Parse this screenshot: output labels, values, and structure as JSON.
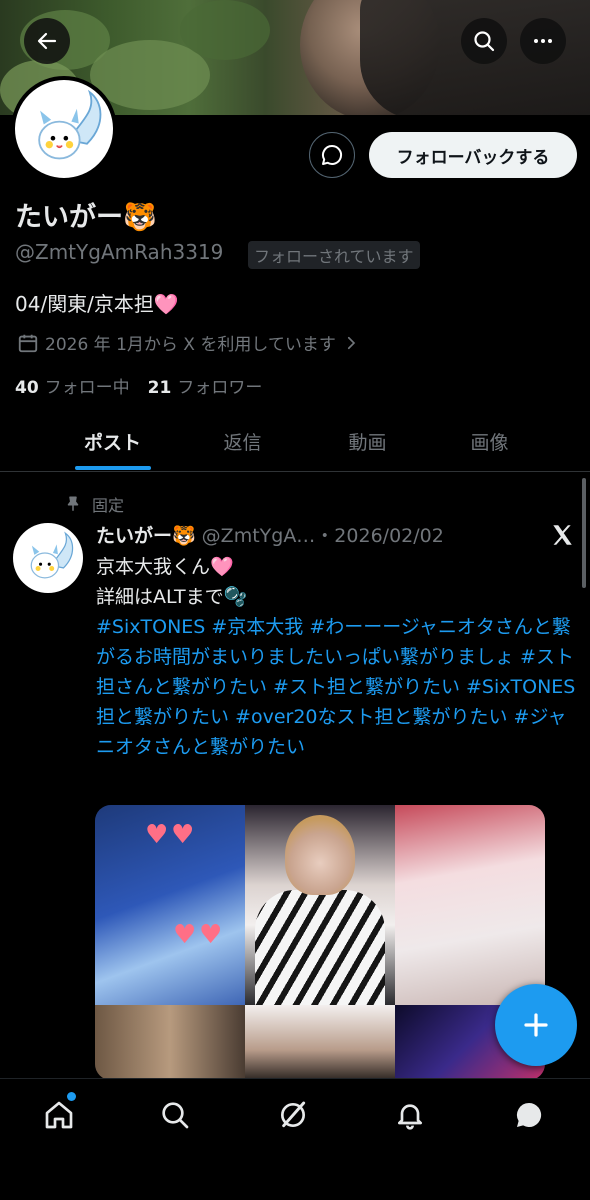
{
  "profile": {
    "display_name": "たいがー🐯",
    "handle": "@ZmtYgAmRah3319",
    "follows_you_label": "フォローされています",
    "bio": "04/関東/京本担🩷",
    "joined": "2026 年 1月から X を利用しています",
    "following_count": "40",
    "following_label": "フォロー中",
    "followers_count": "21",
    "followers_label": "フォロワー",
    "follow_back_label": "フォローバックする"
  },
  "tabs": [
    {
      "label": "ポスト",
      "active": true
    },
    {
      "label": "返信",
      "active": false
    },
    {
      "label": "動画",
      "active": false
    },
    {
      "label": "画像",
      "active": false
    }
  ],
  "post": {
    "pinned_label": "固定",
    "author_name": "たいがー🐯",
    "author_handle_time": "@ZmtYgA…・2026/02/02",
    "line1": "京本大我くん🩷",
    "line2": "詳細はALTまで🫧",
    "hashtags": "#SixTONES #京本大我 #わーーージャニオタさんと繋がるお時間がまいりましたいっぱい繋がりましょ #スト担さんと繋がりたい #スト担と繋がりたい #SixTONES担と繋がりたい #over20なスト担と繋がりたい #ジャニオタさんと繋がりたい"
  },
  "icons": {
    "back": "arrow-left-icon",
    "search": "search-icon",
    "more": "more-icon",
    "message": "message-icon",
    "calendar": "calendar-icon",
    "pin": "pin-icon",
    "x_logo": "x-logo-icon",
    "compose": "plus-icon",
    "nav": [
      "home-icon",
      "search-icon",
      "grok-icon",
      "bell-icon",
      "messages-icon"
    ]
  },
  "colors": {
    "accent": "#1d9bf0",
    "background": "#000000",
    "muted": "#71767b"
  }
}
